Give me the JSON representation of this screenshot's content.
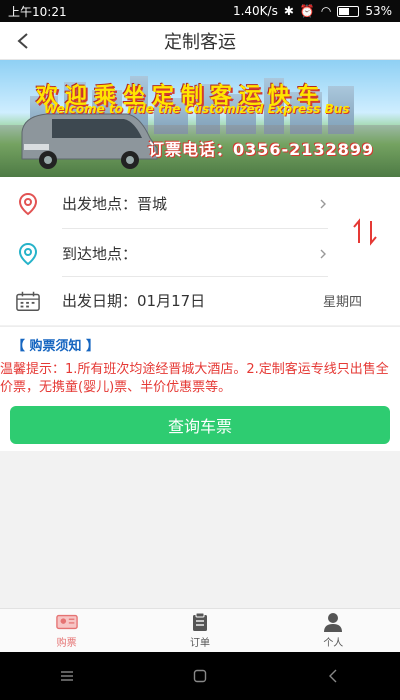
{
  "status_bar": {
    "time": "上午10:21",
    "network_speed": "1.40K/s",
    "battery": "53%"
  },
  "header": {
    "title": "定制客运"
  },
  "banner": {
    "headline": "欢迎乘坐定制客运快车",
    "subline": "Welcome to ride the Customized Express Bus",
    "phone": "订票电话：0356-2132899"
  },
  "form": {
    "departure_label": "出发地点：晋城",
    "arrival_label": "到达地点：",
    "date_label": "出发日期：01月17日",
    "weekday": "星期四"
  },
  "notice": {
    "title": "【 购票须知 】",
    "text": "温馨提示：1.所有班次均途经晋城大酒店。2.定制客运专线只出售全价票，无携童(婴儿)票、半价优惠票等。"
  },
  "actions": {
    "query_label": "查询车票"
  },
  "tabbar": {
    "items": [
      {
        "label": "购票",
        "icon": "ticket-icon",
        "active": true
      },
      {
        "label": "订单",
        "icon": "orders-icon",
        "active": false
      },
      {
        "label": "个人",
        "icon": "person-icon",
        "active": false
      }
    ]
  },
  "colors": {
    "accent_green": "#2ecc71",
    "notice_red": "#e53935",
    "notice_blue": "#1565c0",
    "active_tab": "#e57373"
  }
}
